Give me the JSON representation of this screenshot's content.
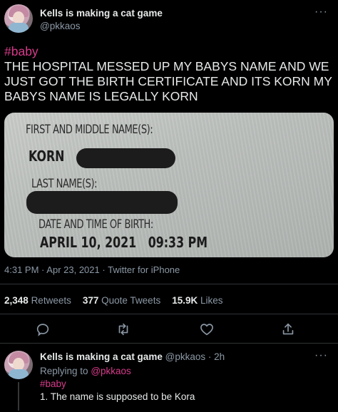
{
  "tweet": {
    "display_name": "Kells is making a cat game",
    "handle": "@pkkaos",
    "more": "···",
    "hashtag": "#baby",
    "text": "THE HOSPITAL MESSED UP MY BABYS NAME AND WE JUST GOT THE BIRTH CERTIFICATE AND ITS KORN MY BABYS NAME IS LEGALLY KORN"
  },
  "certificate": {
    "first_middle_label": "FIRST AND MIDDLE NAME(S):",
    "first_name": "KORN",
    "last_name_label": "LAST NAME(S):",
    "dob_label": "DATE AND TIME OF BIRTH:",
    "dob_value": "APRIL 10, 2021   09:33 PM"
  },
  "meta": {
    "time": "4:31 PM",
    "date": "Apr 23, 2021",
    "source": "Twitter for iPhone",
    "separator": "·"
  },
  "stats": {
    "retweets_count": "2,348",
    "retweets_label": "Retweets",
    "quotes_count": "377",
    "quotes_label": "Quote Tweets",
    "likes_count": "15.9K",
    "likes_label": "Likes"
  },
  "actions": [
    "reply-icon",
    "retweet-icon",
    "like-icon",
    "share-icon"
  ],
  "reply": {
    "display_name": "Kells is making a cat game",
    "handle_time": "@pkkaos · 2h",
    "replying_prefix": "Replying to",
    "replying_to": "@pkkaos",
    "hashtag": "#baby",
    "text": "1. The name is supposed to be Kora",
    "more": "···"
  },
  "colors": {
    "background": "#000000",
    "accent": "#d73b8a",
    "muted": "#8b98a5",
    "text": "#e7e9ea"
  }
}
